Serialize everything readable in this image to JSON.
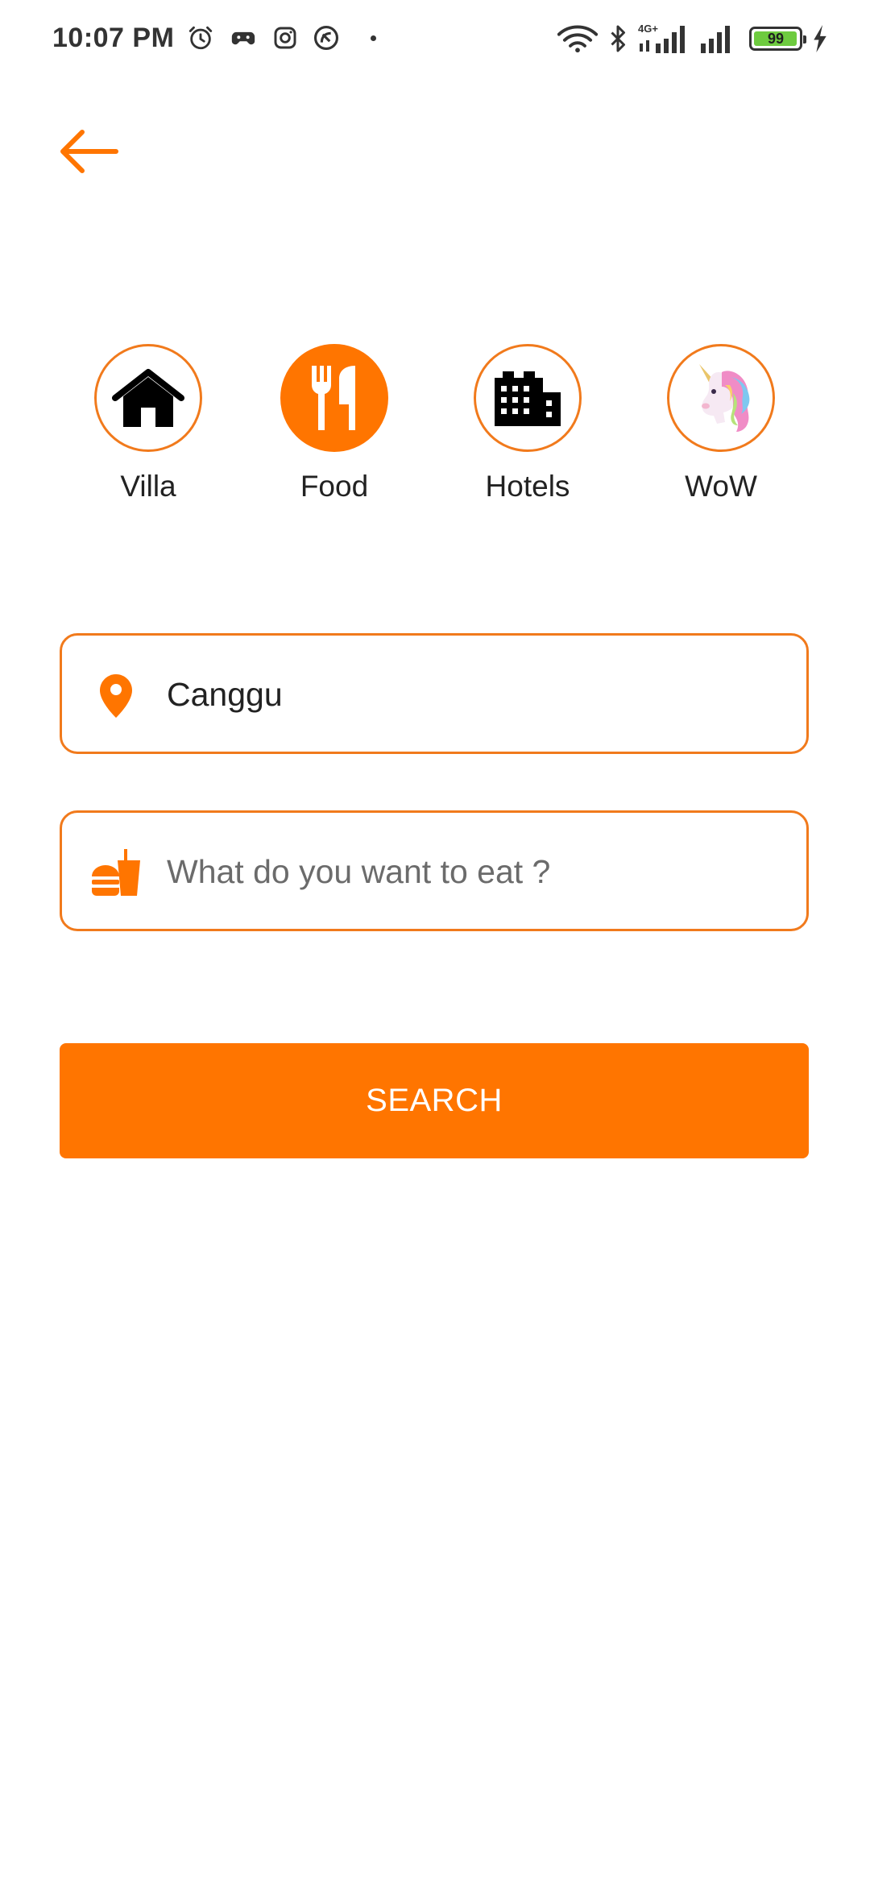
{
  "status_bar": {
    "time": "10:07 PM",
    "network_label": "4G+",
    "battery_level": "99",
    "battery_fraction": 0.99
  },
  "colors": {
    "accent": "#ff7500",
    "outline": "#f17a1c",
    "text": "#222222",
    "placeholder": "#6b6b6b"
  },
  "header": {
    "back_icon": "arrow-left-icon"
  },
  "categories": [
    {
      "label": "Villa",
      "icon": "house-icon",
      "active": false
    },
    {
      "label": "Food",
      "icon": "fork-knife-icon",
      "active": true
    },
    {
      "label": "Hotels",
      "icon": "buildings-icon",
      "active": false
    },
    {
      "label": "WoW",
      "icon": "unicorn-icon",
      "active": false
    }
  ],
  "search": {
    "location_value": "Canggu",
    "location_icon": "location-pin-icon",
    "food_value": "",
    "food_placeholder": "What do you want to eat ?",
    "food_icon": "fastfood-icon",
    "button_label": "SEARCH"
  }
}
